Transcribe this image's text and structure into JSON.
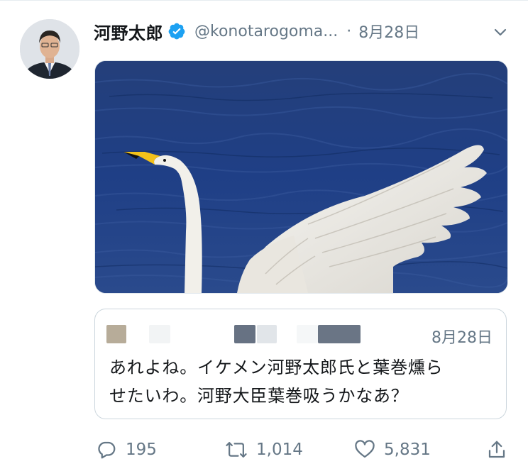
{
  "tweet": {
    "author": {
      "display_name": "河野太郎",
      "handle": "@konotarogoma...",
      "verified": true
    },
    "separator": "·",
    "timestamp": "8月28日",
    "media": {
      "alt": "swan spreading wings on blue water"
    }
  },
  "quoted_tweet": {
    "timestamp": "8月28日",
    "text_line1": "あれよね。イケメン河野太郎氏と葉巻燻ら",
    "text_line2": "せたいわ。河野大臣葉巻吸うかなあ？"
  },
  "actions": {
    "reply_count": "195",
    "retweet_count": "1,014",
    "like_count": "5,831"
  },
  "colors": {
    "verified": "#1da1f2",
    "secondary_text": "#657786",
    "border": "#ccd6dd"
  }
}
